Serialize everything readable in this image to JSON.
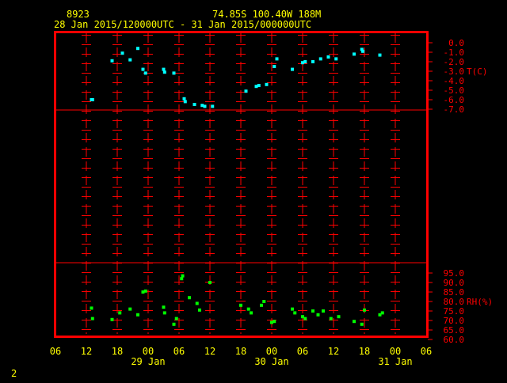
{
  "header": {
    "station_id": "8923",
    "location": "74.85S  100.40W   188M",
    "time_range": "28 Jan 2015/120000UTC - 31 Jan 2015/000000UTC"
  },
  "footer": {
    "page_number": "2"
  },
  "colors": {
    "background": "#000000",
    "text": "#ffff00",
    "frame": "#ff0000",
    "temperature": "#00ffff",
    "humidity": "#00ff00"
  },
  "chart_data": {
    "type": "scatter",
    "x_axis": {
      "unit": "hours since 28 Jan 2015 12UTC",
      "range": [
        -6,
        66
      ],
      "ticks": [
        {
          "x": -6,
          "label": "06"
        },
        {
          "x": 0,
          "label": "12"
        },
        {
          "x": 6,
          "label": "18"
        },
        {
          "x": 12,
          "label": "00"
        },
        {
          "x": 18,
          "label": "06"
        },
        {
          "x": 24,
          "label": "12"
        },
        {
          "x": 30,
          "label": "18"
        },
        {
          "x": 36,
          "label": "00"
        },
        {
          "x": 42,
          "label": "06"
        },
        {
          "x": 48,
          "label": "12"
        },
        {
          "x": 54,
          "label": "18"
        },
        {
          "x": 60,
          "label": "00"
        },
        {
          "x": 66,
          "label": "06"
        }
      ],
      "day_labels": [
        {
          "x": 12,
          "label": "29 Jan"
        },
        {
          "x": 36,
          "label": "30 Jan"
        },
        {
          "x": 60,
          "label": "31 Jan"
        }
      ]
    },
    "panels": [
      {
        "name": "temperature",
        "ylabel": "T(C)",
        "yrange": [
          -7,
          0
        ],
        "ticks": [
          {
            "v": 0,
            "label": "0.0"
          },
          {
            "v": -1,
            "label": "-1.0"
          },
          {
            "v": -2,
            "label": "-2.0"
          },
          {
            "v": -3,
            "label": "-3.0"
          },
          {
            "v": -4,
            "label": "-4.0"
          },
          {
            "v": -5,
            "label": "-5.0"
          },
          {
            "v": -6,
            "label": "-6.0"
          },
          {
            "v": -7,
            "label": "-7.0"
          }
        ],
        "label_at": -3,
        "points": [
          [
            1,
            -6.0
          ],
          [
            1.2,
            -6.0
          ],
          [
            5,
            -1.9
          ],
          [
            7,
            -1.1
          ],
          [
            8.5,
            -1.8
          ],
          [
            10,
            -0.6
          ],
          [
            11,
            -2.8
          ],
          [
            11.5,
            -3.2
          ],
          [
            15,
            -2.8
          ],
          [
            15.2,
            -3.1
          ],
          [
            17,
            -3.2
          ],
          [
            19,
            -5.9
          ],
          [
            19.2,
            -6.2
          ],
          [
            21,
            -6.5
          ],
          [
            22.5,
            -6.6
          ],
          [
            23,
            -6.7
          ],
          [
            24.5,
            -6.7
          ],
          [
            31,
            -5.1
          ],
          [
            33,
            -4.6
          ],
          [
            33.5,
            -4.5
          ],
          [
            35,
            -4.4
          ],
          [
            36.5,
            -2.5
          ],
          [
            37,
            -1.7
          ],
          [
            40,
            -2.8
          ],
          [
            42,
            -2.1
          ],
          [
            42.5,
            -2.0
          ],
          [
            44,
            -2.0
          ],
          [
            45.5,
            -1.7
          ],
          [
            47,
            -1.5
          ],
          [
            48.5,
            -1.7
          ],
          [
            52,
            -1.2
          ],
          [
            53.5,
            -0.7
          ],
          [
            53.7,
            -0.9
          ],
          [
            57,
            -1.3
          ]
        ]
      },
      {
        "name": "humidity",
        "ylabel": "RH(%)",
        "yrange": [
          60,
          95
        ],
        "ticks": [
          {
            "v": 95,
            "label": "95.0"
          },
          {
            "v": 90,
            "label": "90.0"
          },
          {
            "v": 85,
            "label": "85.0"
          },
          {
            "v": 80,
            "label": "80.0"
          },
          {
            "v": 75,
            "label": "75.0"
          },
          {
            "v": 70,
            "label": "70.0"
          },
          {
            "v": 65,
            "label": "65.0"
          },
          {
            "v": 60,
            "label": "60.0"
          }
        ],
        "label_at": 80,
        "points": [
          [
            1,
            76.5
          ],
          [
            1.2,
            71
          ],
          [
            5,
            70.5
          ],
          [
            6.5,
            74
          ],
          [
            8.5,
            76
          ],
          [
            10,
            73
          ],
          [
            11,
            85
          ],
          [
            11.5,
            85.5
          ],
          [
            15,
            77
          ],
          [
            15.2,
            74
          ],
          [
            17,
            68
          ],
          [
            17.5,
            71
          ],
          [
            18.5,
            92
          ],
          [
            18.7,
            93.5
          ],
          [
            20,
            82
          ],
          [
            21.5,
            79
          ],
          [
            22,
            75.5
          ],
          [
            24,
            90
          ],
          [
            30,
            78
          ],
          [
            31.5,
            76
          ],
          [
            32,
            74
          ],
          [
            34,
            78
          ],
          [
            34.5,
            80
          ],
          [
            36,
            69
          ],
          [
            36.5,
            69.5
          ],
          [
            40,
            76
          ],
          [
            40.5,
            74
          ],
          [
            42,
            72
          ],
          [
            42.5,
            71
          ],
          [
            44,
            75
          ],
          [
            45,
            73
          ],
          [
            46,
            75
          ],
          [
            47.5,
            71
          ],
          [
            49,
            72
          ],
          [
            52,
            69.5
          ],
          [
            53.5,
            68
          ],
          [
            54,
            75.5
          ],
          [
            57,
            73
          ],
          [
            57.5,
            74
          ]
        ]
      }
    ],
    "grid": "dashed vertical lines every 6 h"
  }
}
